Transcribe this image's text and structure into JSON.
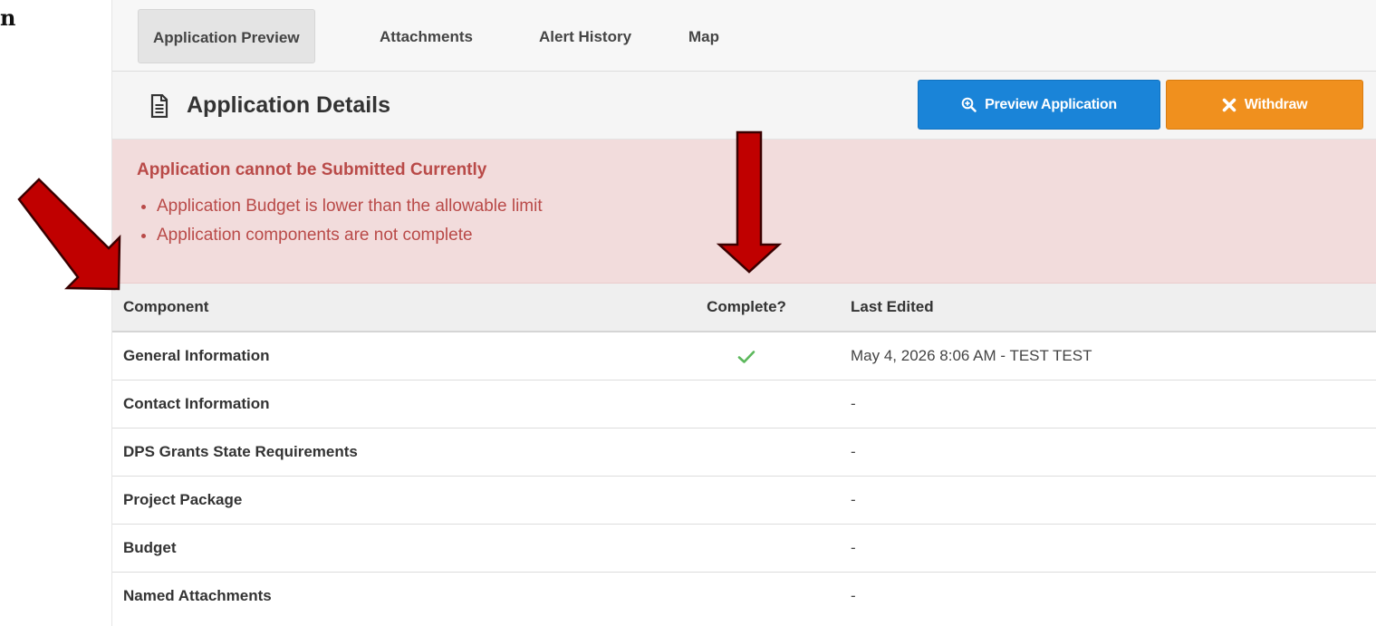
{
  "edge_glyph": "n",
  "tabs": [
    {
      "label": "Application Preview",
      "active": true
    },
    {
      "label": "Attachments",
      "active": false
    },
    {
      "label": "Alert History",
      "active": false
    },
    {
      "label": "Map",
      "active": false
    }
  ],
  "header": {
    "title": "Application Details",
    "title_icon": "document-icon",
    "preview_button": {
      "label": "Preview Application",
      "icon": "zoom-in-icon",
      "color": "#1a84d8"
    },
    "withdraw_button": {
      "label": "Withdraw",
      "icon": "close-icon",
      "color": "#f0901e"
    }
  },
  "alert": {
    "title": "Application cannot be Submitted Currently",
    "items": [
      "Application Budget is lower than the allowable limit",
      "Application components are not complete"
    ],
    "color": "#b94a48",
    "background": "#f2dcdc"
  },
  "table": {
    "columns": [
      "Component",
      "Complete?",
      "Last Edited"
    ],
    "rows": [
      {
        "component": "General Information",
        "complete": true,
        "last_edited": "May 4, 2026 8:06 AM - TEST TEST"
      },
      {
        "component": "Contact Information",
        "complete": false,
        "last_edited": "-"
      },
      {
        "component": "DPS Grants State Requirements",
        "complete": false,
        "last_edited": "-"
      },
      {
        "component": "Project Package",
        "complete": false,
        "last_edited": "-"
      },
      {
        "component": "Budget",
        "complete": false,
        "last_edited": "-"
      },
      {
        "component": "Named Attachments",
        "complete": false,
        "last_edited": "-"
      }
    ]
  },
  "annotations": {
    "arrow_color": "#c00000",
    "arrows": [
      "diagonal-arrow",
      "down-arrow"
    ]
  }
}
